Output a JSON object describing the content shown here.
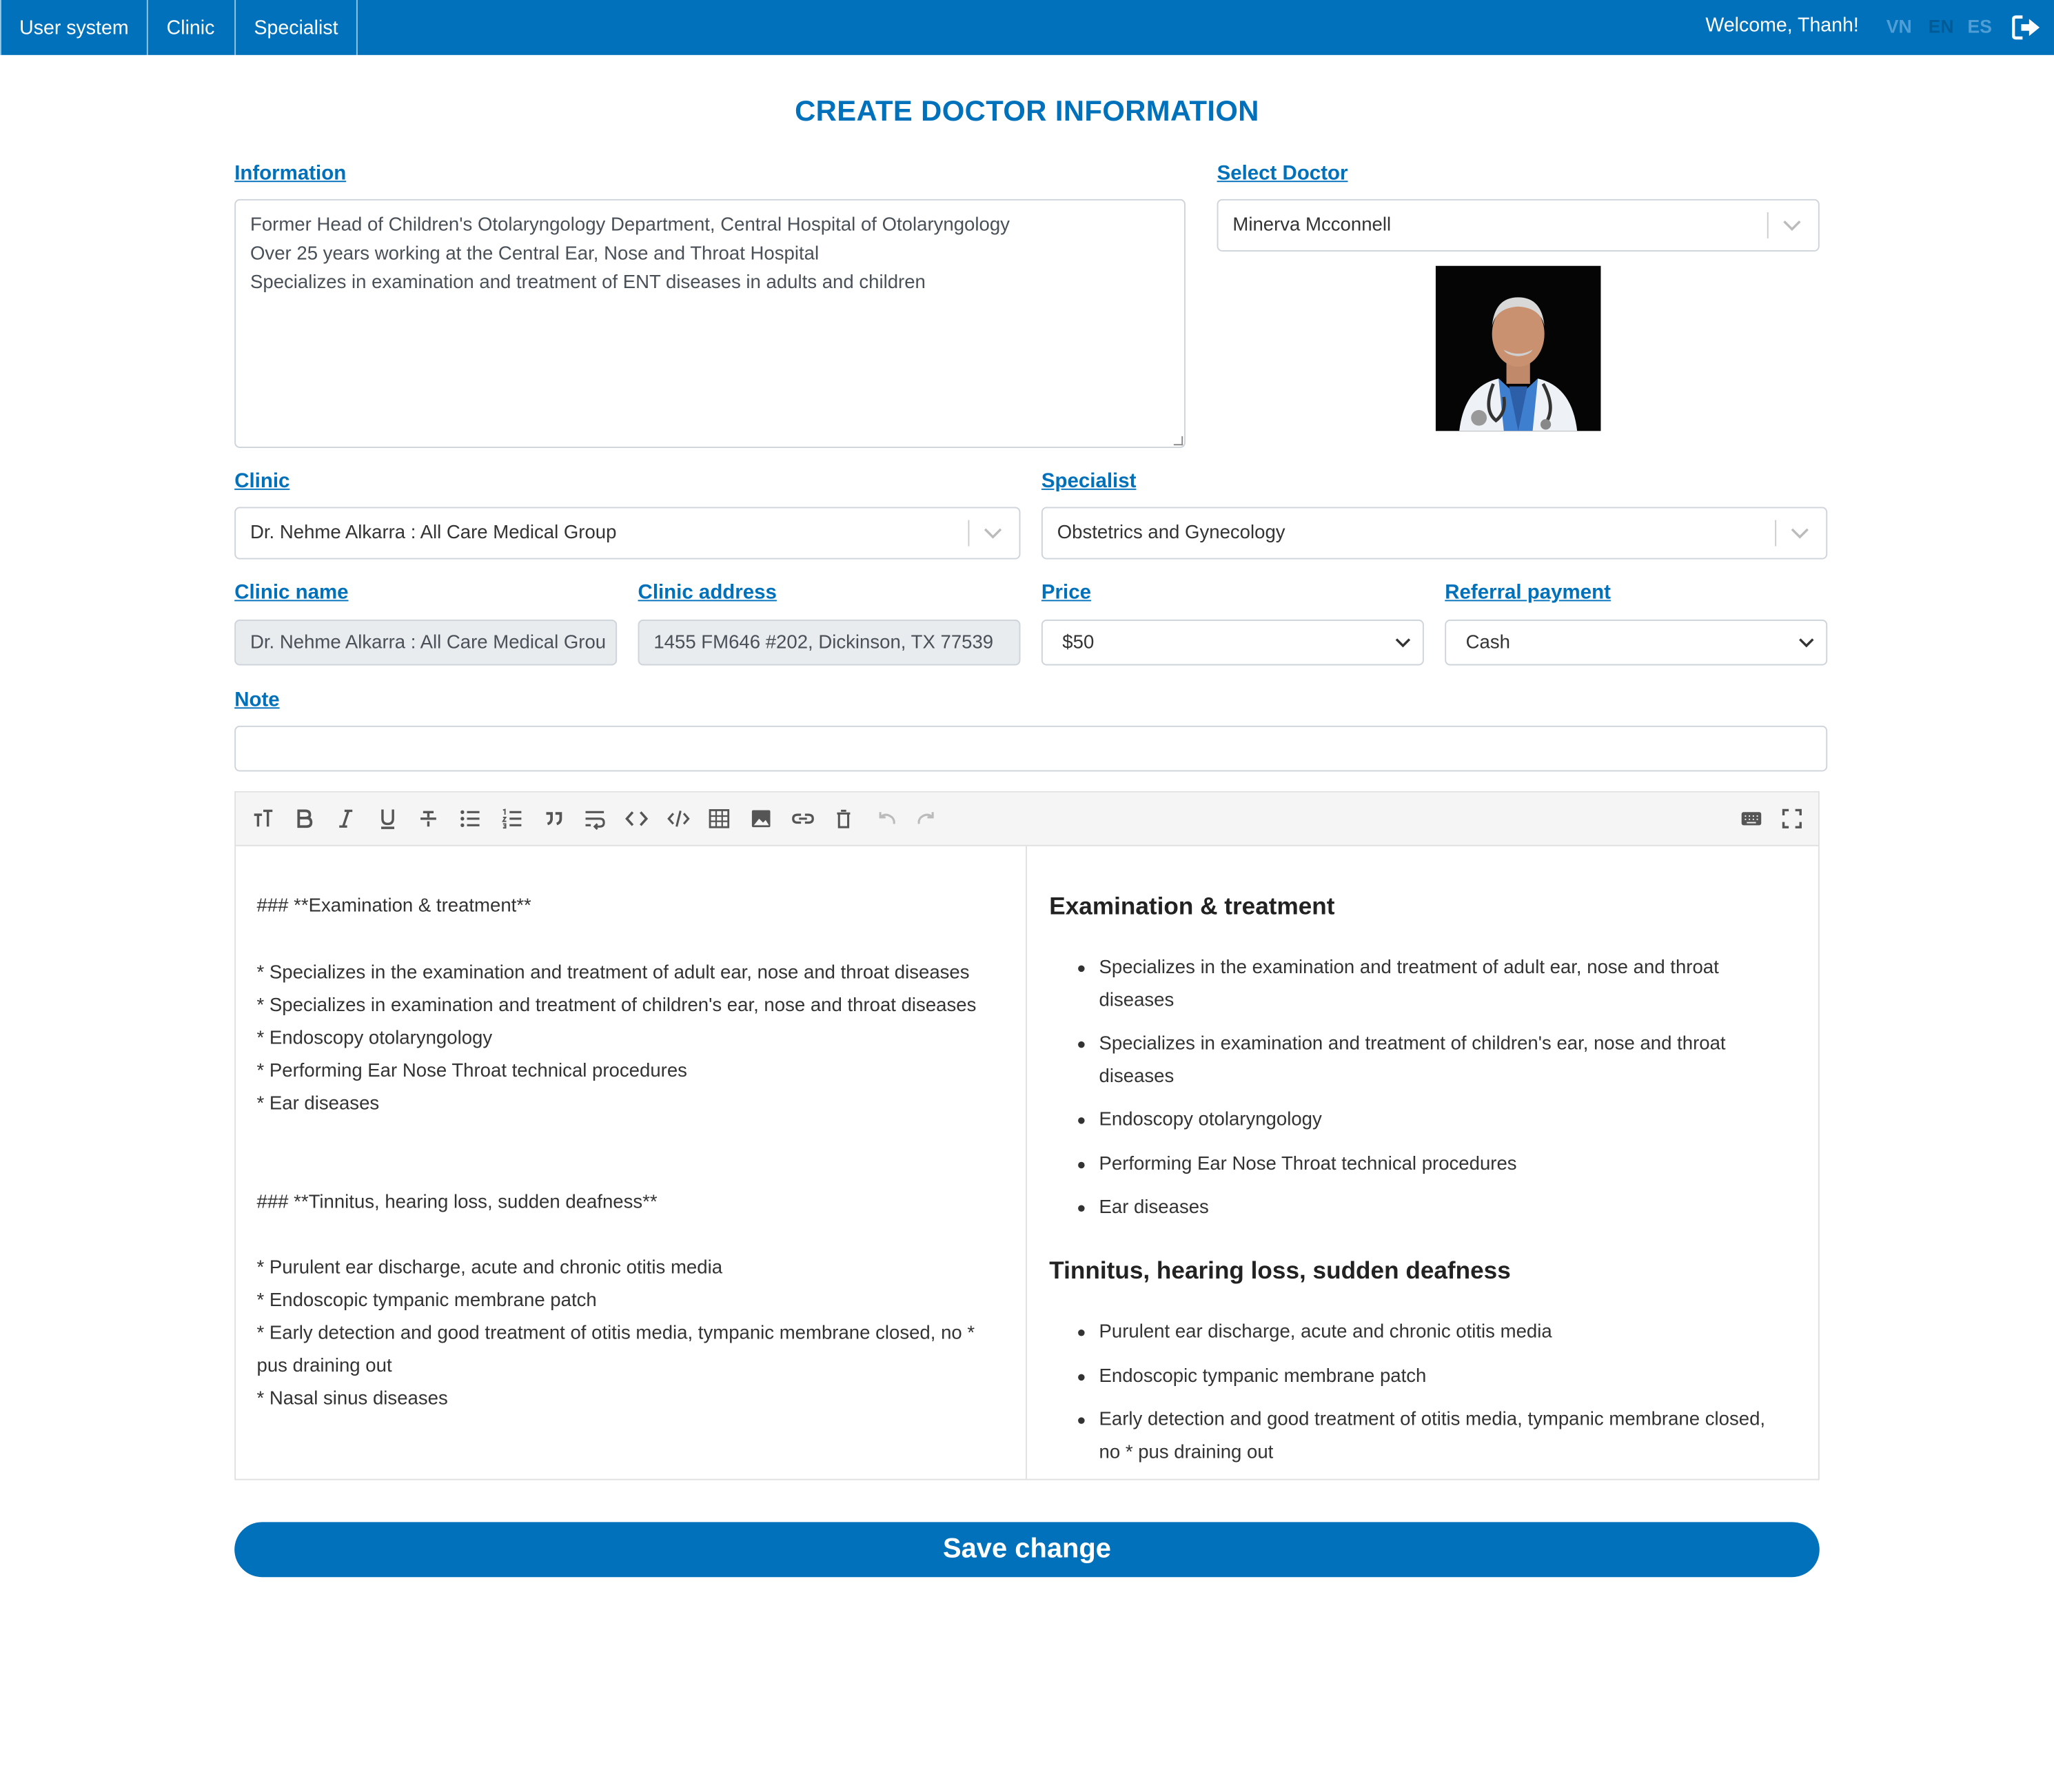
{
  "nav": {
    "items": [
      "User system",
      "Clinic",
      "Specialist"
    ]
  },
  "header": {
    "welcome": "Welcome, Thanh!",
    "languages": [
      "VN",
      "EN",
      "ES"
    ],
    "active_language": "EN"
  },
  "page_title": "CREATE DOCTOR INFORMATION",
  "information": {
    "label": "Information",
    "lines": [
      "Former Head of Children's Otolaryngology Department, Central Hospital of Otolaryngology",
      "Over 25 years working at the Central Ear, Nose and Throat Hospital",
      "Specializes in examination and treatment of ENT diseases in adults and children"
    ]
  },
  "select_doctor": {
    "label": "Select Doctor",
    "value": "Minerva Mcconnell"
  },
  "clinic": {
    "label": "Clinic",
    "value": "Dr. Nehme Alkarra : All Care Medical Group"
  },
  "specialist": {
    "label": "Specialist",
    "value": "Obstetrics and Gynecology"
  },
  "clinic_name": {
    "label": "Clinic name",
    "value": "Dr. Nehme Alkarra : All Care Medical Group"
  },
  "clinic_address": {
    "label": "Clinic address",
    "value": "1455 FM646 #202, Dickinson, TX 77539"
  },
  "price": {
    "label": "Price",
    "value": "$50"
  },
  "referral_payment": {
    "label": "Referral payment",
    "value": "Cash"
  },
  "note": {
    "label": "Note",
    "value": ""
  },
  "editor": {
    "markdown_lines": [
      "### **Examination & treatment**",
      "* Specializes in the examination and treatment of adult ear, nose and throat diseases",
      "* Specializes in examination and treatment of children's ear, nose and throat diseases",
      "* Endoscopy otolaryngology",
      "* Performing Ear Nose Throat technical procedures",
      "* Ear diseases",
      "### **Tinnitus, hearing loss, sudden deafness**",
      "* Purulent ear discharge, acute and chronic otitis media",
      "* Endoscopic tympanic membrane patch",
      "* Early detection and good treatment of otitis media, tympanic membrane closed, no *",
      "pus draining out",
      "* Nasal sinus diseases"
    ],
    "preview": {
      "heading1": "Examination & treatment",
      "list1": [
        "Specializes in the examination and treatment of adult ear, nose and throat diseases",
        "Specializes in examination and treatment of children's ear, nose and throat diseases",
        "Endoscopy otolaryngology",
        "Performing Ear Nose Throat technical procedures",
        "Ear diseases"
      ],
      "heading2": "Tinnitus, hearing loss, sudden deafness",
      "list2": [
        "Purulent ear discharge, acute and chronic otitis media",
        "Endoscopic tympanic membrane patch",
        "Early detection and good treatment of otitis media, tympanic membrane closed, no * pus draining out"
      ]
    },
    "toolbar_icons": [
      "heading-icon",
      "bold-icon",
      "italic-icon",
      "underline-icon",
      "strikethrough-icon",
      "bullet-list-icon",
      "numbered-list-icon",
      "quote-icon",
      "wrap-icon",
      "inline-code-icon",
      "code-block-icon",
      "table-icon",
      "image-icon",
      "link-icon",
      "clear-icon",
      "undo-icon",
      "redo-icon",
      "keyboard-icon",
      "fullscreen-icon"
    ]
  },
  "save_button": "Save change",
  "colors": {
    "primary": "#0071ba",
    "lang_inactive": "#4f9fd6",
    "lang_active": "#005a96"
  }
}
